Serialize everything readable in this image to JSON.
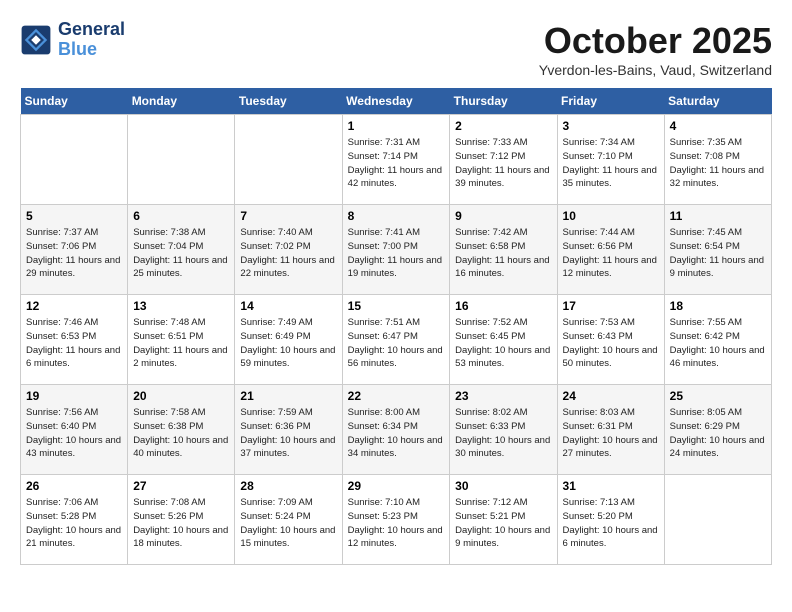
{
  "header": {
    "logo_line1": "General",
    "logo_line2": "Blue",
    "month": "October 2025",
    "location": "Yverdon-les-Bains, Vaud, Switzerland"
  },
  "days_of_week": [
    "Sunday",
    "Monday",
    "Tuesday",
    "Wednesday",
    "Thursday",
    "Friday",
    "Saturday"
  ],
  "weeks": [
    [
      {
        "day": "",
        "empty": true
      },
      {
        "day": "",
        "empty": true
      },
      {
        "day": "",
        "empty": true
      },
      {
        "day": "1",
        "sunrise": "7:31 AM",
        "sunset": "7:14 PM",
        "daylight": "11 hours and 42 minutes."
      },
      {
        "day": "2",
        "sunrise": "7:33 AM",
        "sunset": "7:12 PM",
        "daylight": "11 hours and 39 minutes."
      },
      {
        "day": "3",
        "sunrise": "7:34 AM",
        "sunset": "7:10 PM",
        "daylight": "11 hours and 35 minutes."
      },
      {
        "day": "4",
        "sunrise": "7:35 AM",
        "sunset": "7:08 PM",
        "daylight": "11 hours and 32 minutes."
      }
    ],
    [
      {
        "day": "5",
        "sunrise": "7:37 AM",
        "sunset": "7:06 PM",
        "daylight": "11 hours and 29 minutes."
      },
      {
        "day": "6",
        "sunrise": "7:38 AM",
        "sunset": "7:04 PM",
        "daylight": "11 hours and 25 minutes."
      },
      {
        "day": "7",
        "sunrise": "7:40 AM",
        "sunset": "7:02 PM",
        "daylight": "11 hours and 22 minutes."
      },
      {
        "day": "8",
        "sunrise": "7:41 AM",
        "sunset": "7:00 PM",
        "daylight": "11 hours and 19 minutes."
      },
      {
        "day": "9",
        "sunrise": "7:42 AM",
        "sunset": "6:58 PM",
        "daylight": "11 hours and 16 minutes."
      },
      {
        "day": "10",
        "sunrise": "7:44 AM",
        "sunset": "6:56 PM",
        "daylight": "11 hours and 12 minutes."
      },
      {
        "day": "11",
        "sunrise": "7:45 AM",
        "sunset": "6:54 PM",
        "daylight": "11 hours and 9 minutes."
      }
    ],
    [
      {
        "day": "12",
        "sunrise": "7:46 AM",
        "sunset": "6:53 PM",
        "daylight": "11 hours and 6 minutes."
      },
      {
        "day": "13",
        "sunrise": "7:48 AM",
        "sunset": "6:51 PM",
        "daylight": "11 hours and 2 minutes."
      },
      {
        "day": "14",
        "sunrise": "7:49 AM",
        "sunset": "6:49 PM",
        "daylight": "10 hours and 59 minutes."
      },
      {
        "day": "15",
        "sunrise": "7:51 AM",
        "sunset": "6:47 PM",
        "daylight": "10 hours and 56 minutes."
      },
      {
        "day": "16",
        "sunrise": "7:52 AM",
        "sunset": "6:45 PM",
        "daylight": "10 hours and 53 minutes."
      },
      {
        "day": "17",
        "sunrise": "7:53 AM",
        "sunset": "6:43 PM",
        "daylight": "10 hours and 50 minutes."
      },
      {
        "day": "18",
        "sunrise": "7:55 AM",
        "sunset": "6:42 PM",
        "daylight": "10 hours and 46 minutes."
      }
    ],
    [
      {
        "day": "19",
        "sunrise": "7:56 AM",
        "sunset": "6:40 PM",
        "daylight": "10 hours and 43 minutes."
      },
      {
        "day": "20",
        "sunrise": "7:58 AM",
        "sunset": "6:38 PM",
        "daylight": "10 hours and 40 minutes."
      },
      {
        "day": "21",
        "sunrise": "7:59 AM",
        "sunset": "6:36 PM",
        "daylight": "10 hours and 37 minutes."
      },
      {
        "day": "22",
        "sunrise": "8:00 AM",
        "sunset": "6:34 PM",
        "daylight": "10 hours and 34 minutes."
      },
      {
        "day": "23",
        "sunrise": "8:02 AM",
        "sunset": "6:33 PM",
        "daylight": "10 hours and 30 minutes."
      },
      {
        "day": "24",
        "sunrise": "8:03 AM",
        "sunset": "6:31 PM",
        "daylight": "10 hours and 27 minutes."
      },
      {
        "day": "25",
        "sunrise": "8:05 AM",
        "sunset": "6:29 PM",
        "daylight": "10 hours and 24 minutes."
      }
    ],
    [
      {
        "day": "26",
        "sunrise": "7:06 AM",
        "sunset": "5:28 PM",
        "daylight": "10 hours and 21 minutes."
      },
      {
        "day": "27",
        "sunrise": "7:08 AM",
        "sunset": "5:26 PM",
        "daylight": "10 hours and 18 minutes."
      },
      {
        "day": "28",
        "sunrise": "7:09 AM",
        "sunset": "5:24 PM",
        "daylight": "10 hours and 15 minutes."
      },
      {
        "day": "29",
        "sunrise": "7:10 AM",
        "sunset": "5:23 PM",
        "daylight": "10 hours and 12 minutes."
      },
      {
        "day": "30",
        "sunrise": "7:12 AM",
        "sunset": "5:21 PM",
        "daylight": "10 hours and 9 minutes."
      },
      {
        "day": "31",
        "sunrise": "7:13 AM",
        "sunset": "5:20 PM",
        "daylight": "10 hours and 6 minutes."
      },
      {
        "day": "",
        "empty": true
      }
    ]
  ]
}
